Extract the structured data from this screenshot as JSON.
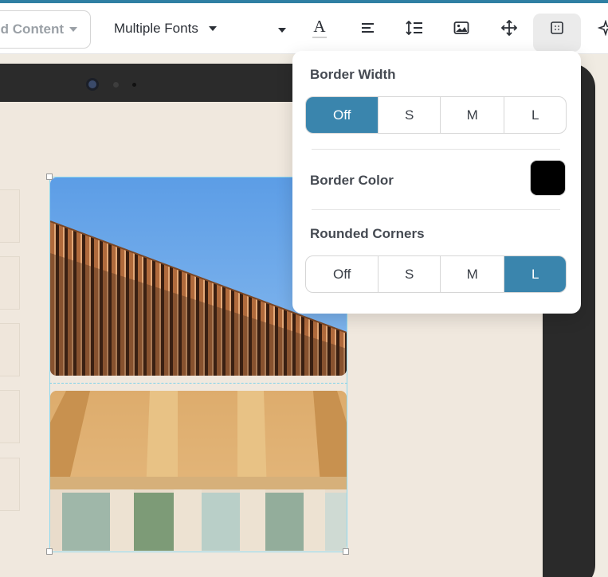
{
  "toolbar": {
    "content_dropdown_label": "d Content",
    "font_dropdown_label": "Multiple Fonts",
    "icons": [
      "text-color-icon",
      "align-icon",
      "line-spacing-icon",
      "image-icon",
      "move-icon",
      "border-icon",
      "sparkle-icon"
    ],
    "text_color_letter": "A"
  },
  "popover": {
    "border_width": {
      "title": "Border Width",
      "options": [
        "Off",
        "S",
        "M",
        "L"
      ],
      "selected": "Off"
    },
    "border_color": {
      "title": "Border Color",
      "value": "#000000"
    },
    "rounded_corners": {
      "title": "Rounded Corners",
      "options": [
        "Off",
        "S",
        "M",
        "L"
      ],
      "selected": "L"
    }
  },
  "colors": {
    "accent": "#3a85ad",
    "top_bar": "#2f7fa3",
    "canvas": "#f0e8de",
    "selection": "#7fd2ea"
  },
  "canvas": {
    "images": [
      "sky-slats-photo",
      "timber-ceiling-photo"
    ]
  }
}
